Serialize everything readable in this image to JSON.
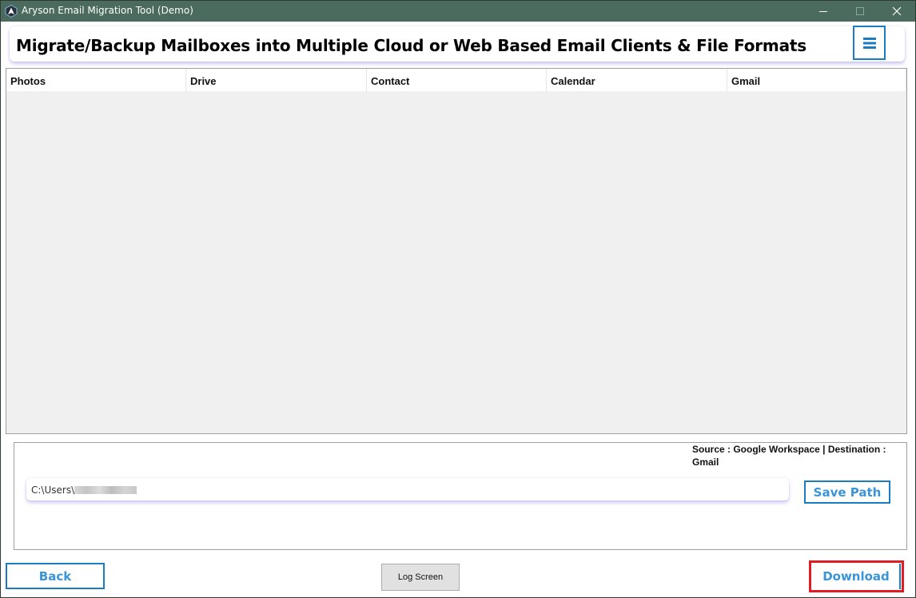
{
  "window": {
    "title": "Aryson Email Migration Tool (Demo)",
    "titlebar_color": "#4a6b5e",
    "controls": [
      "minimize",
      "maximize",
      "close"
    ]
  },
  "header": {
    "title": "Migrate/Backup Mailboxes into Multiple Cloud or Web Based Email Clients & File Formats",
    "menu_icon": "hamburger-menu-icon"
  },
  "grid": {
    "columns": [
      "Photos",
      "Drive",
      "Contact",
      "Calendar",
      "Gmail"
    ],
    "rows": []
  },
  "options": {
    "source_destination": "Source : Google Workspace | Destination : Gmail",
    "path_value": "C:\\Users\\",
    "save_path_label": "Save Path"
  },
  "footer": {
    "back_label": "Back",
    "log_screen_label": "Log Screen",
    "download_label": "Download"
  },
  "colors": {
    "accent": "#1a7dc4",
    "button_text": "#3a95d8",
    "highlight": "#e31b23"
  }
}
